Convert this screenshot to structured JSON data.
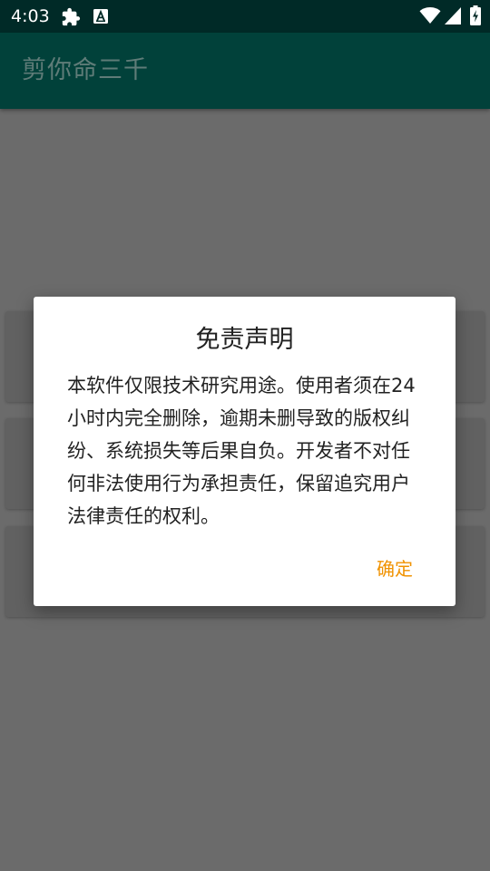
{
  "status_bar": {
    "time": "4:03",
    "icons": [
      "puzzle-icon",
      "font-a-icon",
      "wifi-icon",
      "signal-icon",
      "battery-charging-icon"
    ]
  },
  "app_bar": {
    "title": "剪你命三千"
  },
  "dialog": {
    "title": "免责声明",
    "message": "本软件仅限技术研究用途。使用者须在24小时内完全删除，逾期未删导致的版权纠纷、系统损失等后果自负。开发者不对任何非法使用行为承担责任，保留追究用户法律责任的权利。",
    "confirm_label": "确定"
  },
  "colors": {
    "status_bar": "#002a27",
    "app_bar": "#01413a",
    "scrim": "#6b6b6b",
    "accent": "#f09200"
  }
}
